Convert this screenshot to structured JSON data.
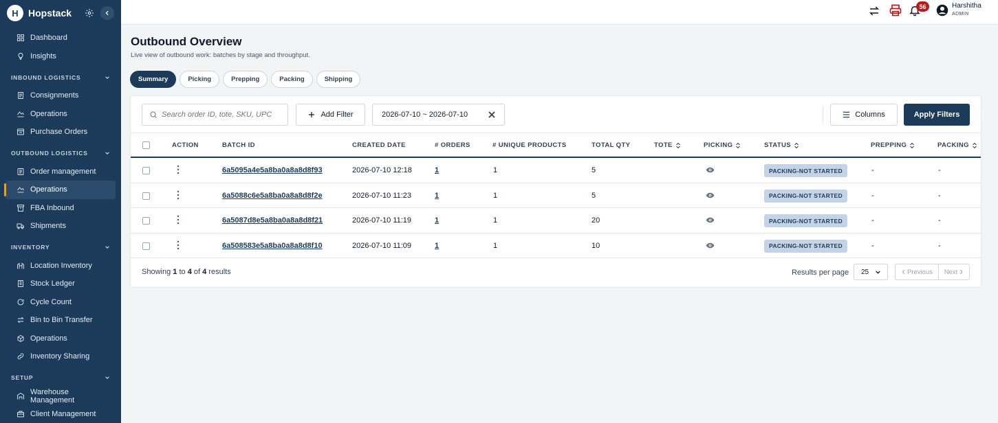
{
  "app": {
    "name": "Hopstack"
  },
  "sidebar": {
    "top_items": [
      {
        "label": "Dashboard",
        "icon": "dashboard-icon"
      },
      {
        "label": "Insights",
        "icon": "lightbulb-icon"
      }
    ],
    "sections": [
      {
        "title": "INBOUND LOGISTICS",
        "items": [
          {
            "label": "Consignments",
            "icon": "document-icon"
          },
          {
            "label": "Operations",
            "icon": "operations-icon"
          },
          {
            "label": "Purchase Orders",
            "icon": "purchase-orders-icon"
          }
        ]
      },
      {
        "title": "OUTBOUND LOGISTICS",
        "items": [
          {
            "label": "Order management",
            "icon": "order-icon"
          },
          {
            "label": "Operations",
            "icon": "operations-icon",
            "active": true
          },
          {
            "label": "FBA Inbound",
            "icon": "fba-icon"
          },
          {
            "label": "Shipments",
            "icon": "truck-icon"
          }
        ]
      },
      {
        "title": "INVENTORY",
        "items": [
          {
            "label": "Location Inventory",
            "icon": "location-inventory-icon"
          },
          {
            "label": "Stock Ledger",
            "icon": "ledger-icon"
          },
          {
            "label": "Cycle Count",
            "icon": "cycle-icon"
          },
          {
            "label": "Bin to Bin Transfer",
            "icon": "transfer-icon"
          },
          {
            "label": "Operations",
            "icon": "box-icon"
          },
          {
            "label": "Inventory Sharing",
            "icon": "link-icon"
          }
        ]
      },
      {
        "title": "SETUP",
        "items": [
          {
            "label": "Warehouse Management",
            "icon": "warehouse-icon"
          },
          {
            "label": "Client Management",
            "icon": "client-icon"
          }
        ]
      }
    ]
  },
  "topbar": {
    "notification_count": "56",
    "user_name": "Harshitha",
    "user_role": "ADMIN"
  },
  "page": {
    "title": "Outbound Overview",
    "subtitle": "Live view of outbound work: batches by stage and throughput."
  },
  "tabs": [
    "Summary",
    "Picking",
    "Prepping",
    "Packing",
    "Shipping"
  ],
  "filters": {
    "search_placeholder": "Search order ID, tote, SKU, UPC",
    "add_filter_label": "Add Filter",
    "date_range": "2026-07-10 ~ 2026-07-10",
    "columns_label": "Columns",
    "apply_label": "Apply Filters"
  },
  "table": {
    "headers": [
      "ACTION",
      "BATCH ID",
      "CREATED DATE",
      "# ORDERS",
      "# UNIQUE PRODUCTS",
      "TOTAL QTY",
      "TOTE",
      "PICKING",
      "STATUS",
      "PREPPING",
      "PACKING"
    ],
    "rows": [
      {
        "batch_id": "6a5095a4e5a8ba0a8a8d8f93",
        "created": "2026-07-10 12:18",
        "orders": "1",
        "unique": "1",
        "qty": "5",
        "tote": "",
        "status": "PACKING-NOT STARTED",
        "prepping": "-",
        "packing": "-"
      },
      {
        "batch_id": "6a5088c6e5a8ba0a8a8d8f2e",
        "created": "2026-07-10 11:23",
        "orders": "1",
        "unique": "1",
        "qty": "5",
        "tote": "",
        "status": "PACKING-NOT STARTED",
        "prepping": "-",
        "packing": "-"
      },
      {
        "batch_id": "6a5087d8e5a8ba0a8a8d8f21",
        "created": "2026-07-10 11:19",
        "orders": "1",
        "unique": "1",
        "qty": "20",
        "tote": "",
        "status": "PACKING-NOT STARTED",
        "prepping": "-",
        "packing": "-"
      },
      {
        "batch_id": "6a508583e5a8ba0a8a8d8f10",
        "created": "2026-07-10 11:09",
        "orders": "1",
        "unique": "1",
        "qty": "10",
        "tote": "",
        "status": "PACKING-NOT STARTED",
        "prepping": "-",
        "packing": "-"
      }
    ]
  },
  "pagination": {
    "showing_prefix": "Showing",
    "from": "1",
    "to_word": "to",
    "to": "4",
    "of_word": "of",
    "total": "4",
    "results_word": "results",
    "results_per_page_label": "Results per page",
    "per_page": "25",
    "previous": "Previous",
    "next": "Next"
  },
  "colors": {
    "sidebar_bg": "#1c3b5a",
    "accent": "#1c3b5a",
    "active_marker": "#f59e0b",
    "badge": "#b91c1c",
    "status_bg": "#c5d3e6"
  }
}
